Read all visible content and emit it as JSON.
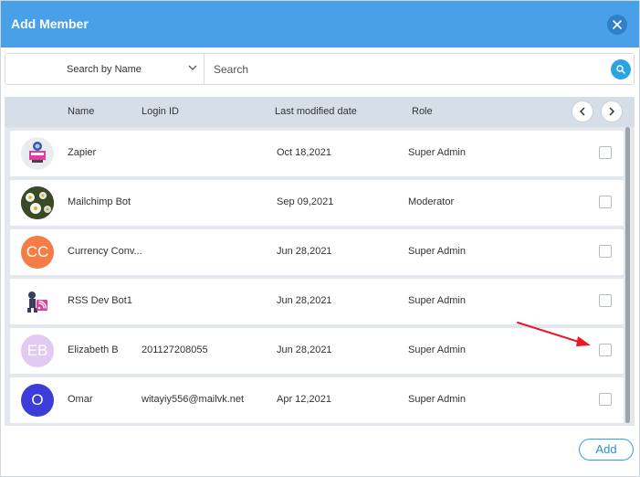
{
  "dialog": {
    "title": "Add Member",
    "close_icon": "close-icon"
  },
  "search": {
    "filter_label": "Search by Name",
    "placeholder": "Search",
    "search_icon": "search-icon"
  },
  "table": {
    "columns": [
      "Name",
      "Login ID",
      "Last modified date",
      "Role"
    ],
    "rows": [
      {
        "name": "Zapier",
        "login_id": "",
        "date": "Oct 18,2021",
        "role": "Super Admin",
        "avatar_type": "image",
        "avatar_icon": "zapier-bot-icon"
      },
      {
        "name": "Mailchimp Bot",
        "login_id": "",
        "date": "Sep 09,2021",
        "role": "Moderator",
        "avatar_type": "image",
        "avatar_icon": "flower-photo-icon"
      },
      {
        "name": "Currency Conv...",
        "login_id": "",
        "date": "Jun 28,2021",
        "role": "Super Admin",
        "avatar_type": "initials",
        "initials": "CC",
        "color": "#f47c45"
      },
      {
        "name": "RSS Dev Bot1",
        "login_id": "",
        "date": "Jun 28,2021",
        "role": "Super Admin",
        "avatar_type": "image",
        "avatar_icon": "rss-bot-icon"
      },
      {
        "name": "Elizabeth B",
        "login_id": "201127208055",
        "date": "Jun 28,2021",
        "role": "Super Admin",
        "avatar_type": "initials",
        "initials": "EB",
        "color": "#e2c9f2"
      },
      {
        "name": "Omar",
        "login_id": "witayiy556@mailvk.net",
        "date": "Apr 12,2021",
        "role": "Super Admin",
        "avatar_type": "initials",
        "initials": "O",
        "color": "#3c3cd9"
      }
    ]
  },
  "footer": {
    "add_label": "Add"
  },
  "colors": {
    "header": "#4a9fe9",
    "accent": "#2ba4e3",
    "annotation_arrow": "#e8192c"
  }
}
